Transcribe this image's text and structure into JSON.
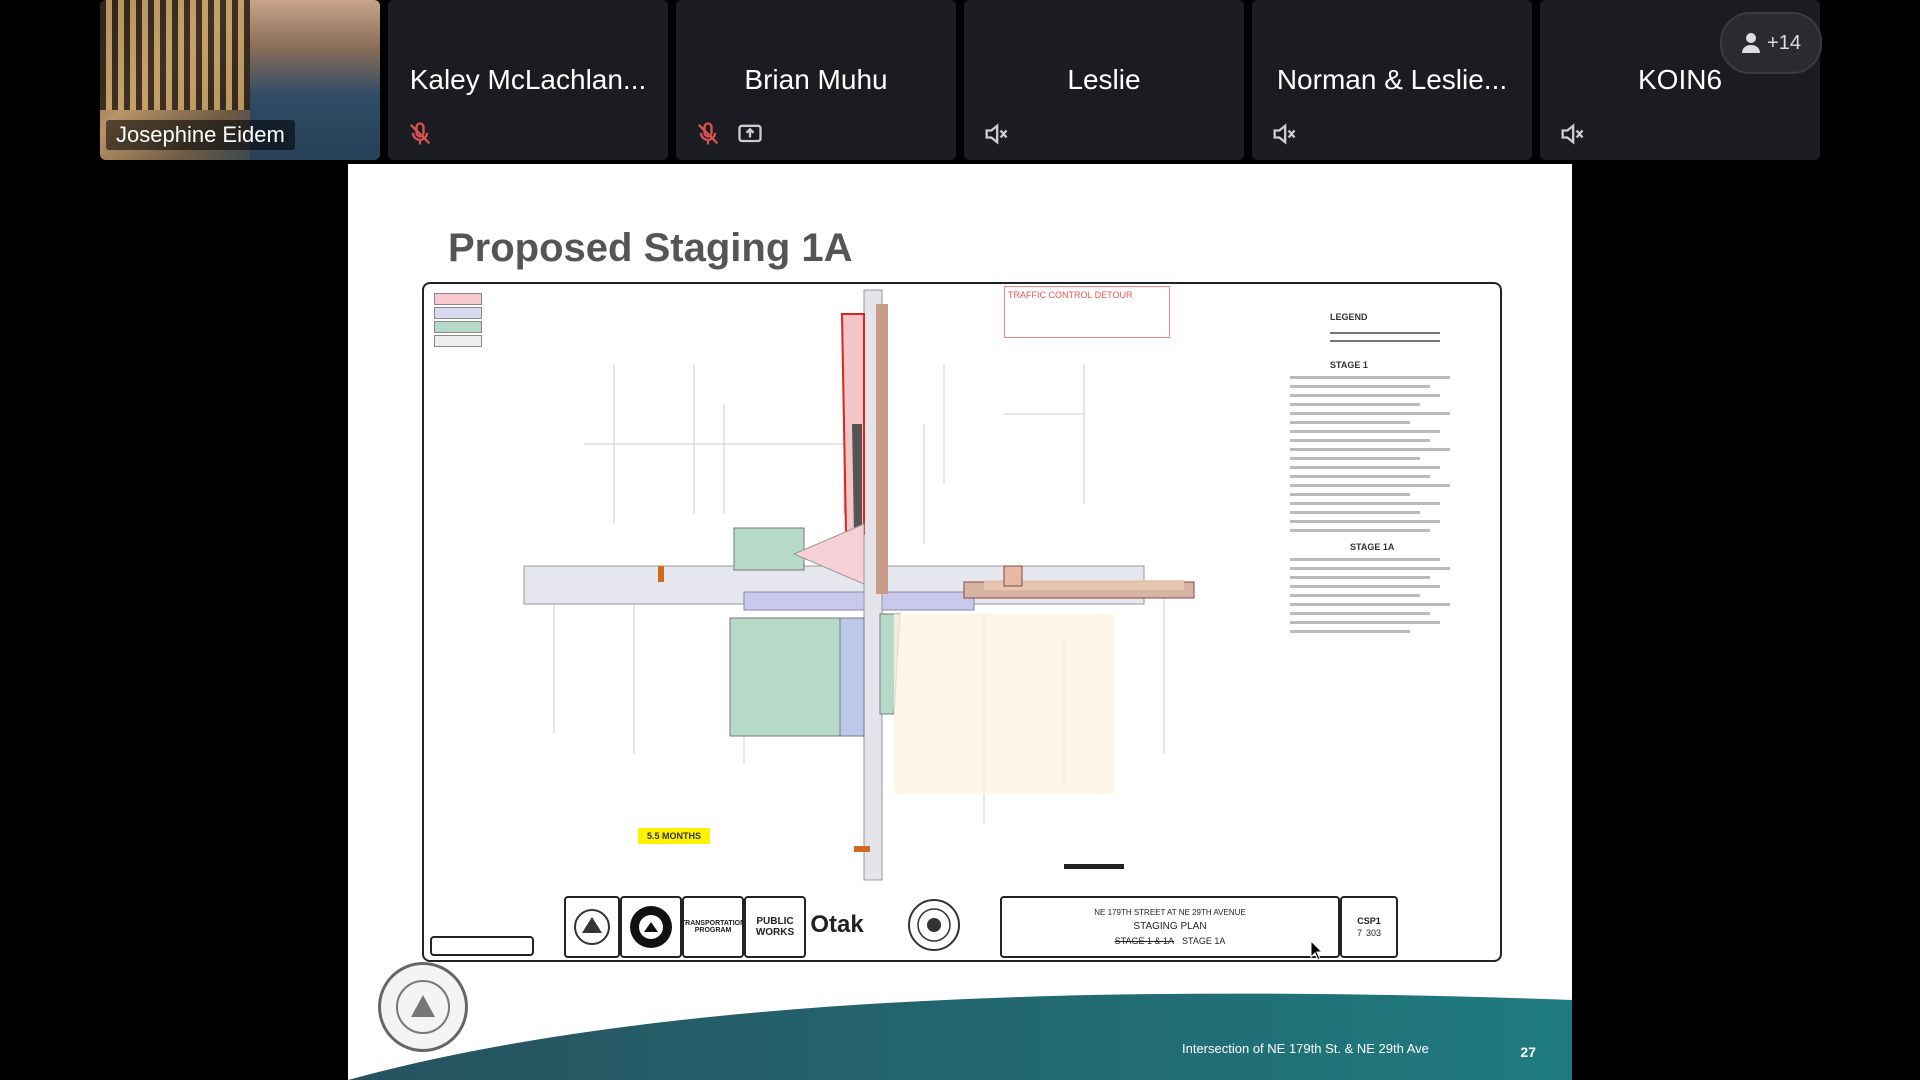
{
  "meeting": {
    "participants": [
      {
        "name": "Josephine Eidem",
        "video": true
      },
      {
        "name": "Kaley McLachlan...",
        "status_icons": [
          "mic-muted-icon"
        ]
      },
      {
        "name": "Brian Muhu",
        "status_icons": [
          "mic-muted-icon",
          "screen-share-icon"
        ]
      },
      {
        "name": "Leslie",
        "status_icons": [
          "speaker-muted-icon"
        ]
      },
      {
        "name": "Norman & Leslie...",
        "status_icons": [
          "speaker-muted-icon"
        ]
      },
      {
        "name": "KOIN6",
        "status_icons": [
          "speaker-muted-icon"
        ]
      }
    ],
    "more_participants": "+14"
  },
  "slide": {
    "title": "Proposed Staging 1A",
    "footer": "Intersection of NE 179th St. & NE 29th Ave",
    "page_number": "27",
    "plan": {
      "traffic_box": "TRAFFIC CONTROL DETOUR",
      "legend_title": "LEGEND",
      "stage1_title": "STAGE 1",
      "stage1a_title": "STAGE 1A",
      "months_tag": "5.5 MONTHS",
      "titleblock": {
        "location": "NE 179TH STREET AT NE 29TH AVENUE",
        "sheet_title": "STAGING PLAN",
        "stage": "STAGE 1 & 1A",
        "stage_new": "STAGE 1A",
        "firm": "Otak",
        "public_works": "PUBLIC WORKS",
        "transportation": "TRANSPORTATION PROGRAM",
        "sheet_id": "CSP1",
        "sheet_no": "7",
        "sheet_of": "303"
      }
    }
  },
  "colors": {
    "tile_bg": "#1b1b22",
    "footer_teal": "#1f6f78"
  }
}
